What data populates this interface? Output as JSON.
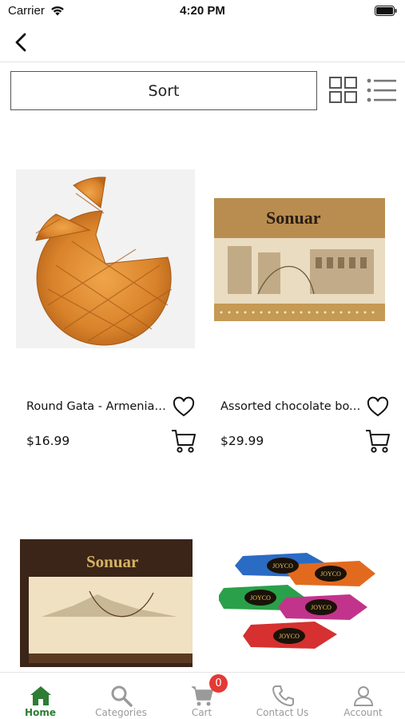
{
  "status_bar": {
    "carrier": "Carrier",
    "time": "4:20 PM"
  },
  "toolbar": {
    "sort_label": "Sort"
  },
  "products": [
    {
      "name": "Round Gata - Armenian P...",
      "price": "$16.99",
      "image": "round-gata-pastry"
    },
    {
      "name": "Assorted chocolate box \"...",
      "price": "$29.99",
      "image": "sonuar-gold-chocolate-box"
    },
    {
      "name": "",
      "price": "",
      "image": "sonuar-brown-chocolate-box"
    },
    {
      "name": "",
      "price": "",
      "image": "joyco-wrapped-candies"
    }
  ],
  "box_brand": "Sonuar",
  "candy_brand": "JOYCO",
  "bottom_nav": {
    "items": [
      {
        "label": "Home",
        "icon": "home-icon",
        "active": true
      },
      {
        "label": "Categories",
        "icon": "search-icon",
        "active": false
      },
      {
        "label": "Cart",
        "icon": "cart-icon",
        "active": false
      },
      {
        "label": "Contact Us",
        "icon": "phone-icon",
        "active": false
      },
      {
        "label": "Account",
        "icon": "user-icon",
        "active": false
      }
    ],
    "cart_count": "0"
  },
  "colors": {
    "accent": "#2e7d32",
    "badge": "#e53935",
    "inactive": "#9a9a9a"
  }
}
